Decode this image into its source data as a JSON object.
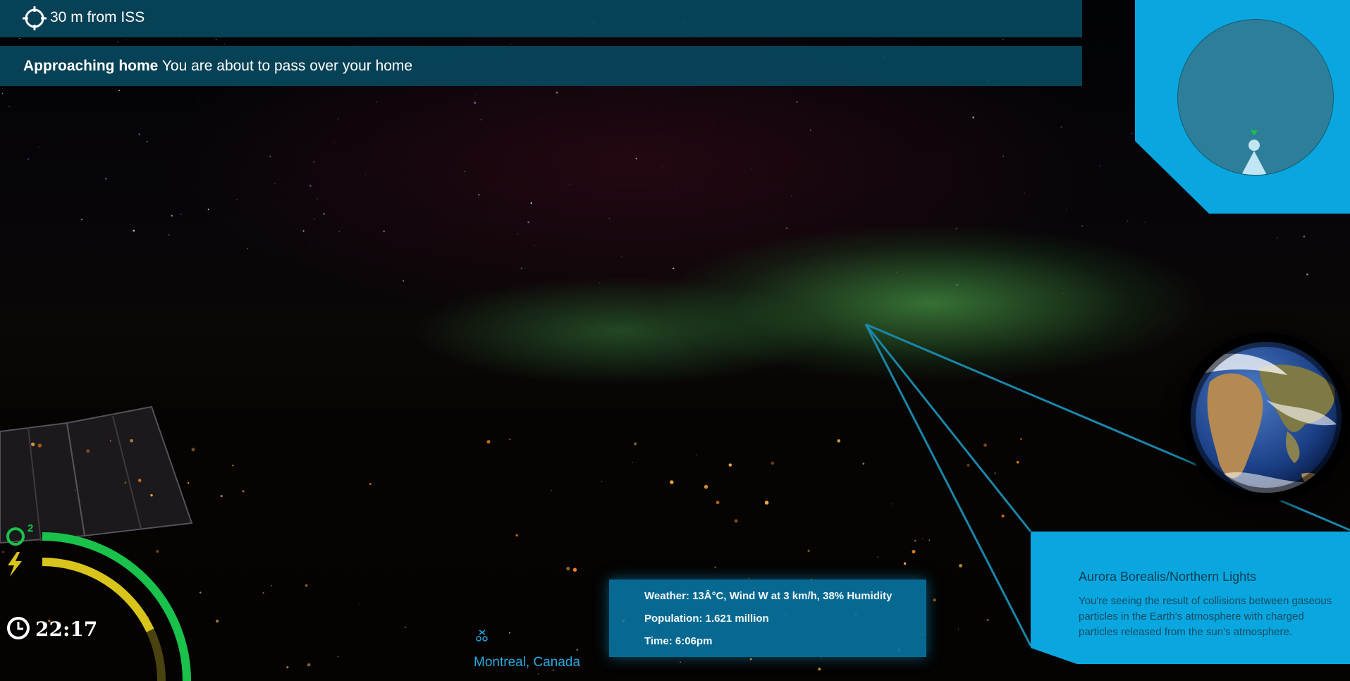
{
  "proximity": {
    "icon": "crosshair-icon",
    "text": "30 m from ISS"
  },
  "notification": {
    "title": "Approaching home",
    "message": "You are about to pass over your home"
  },
  "minimap": {
    "player_icon": "player-marker-icon",
    "direction_icon": "direction-arrow-icon"
  },
  "city": {
    "name": "Montreal, Canada",
    "weather": "Weather: 13Â°C, Wind W at 3 km/h, 38% Humidity",
    "population": "Population: 1.621 million",
    "time": "Time: 6:06pm"
  },
  "info": {
    "title": "Aurora Borealis/Northern Lights",
    "lines": [
      "You're seeing the result of collisions between gaseous",
      "particles in the Earth's atmosphere with charged",
      "particles released from the sun's atmosphere."
    ]
  },
  "status": {
    "oxygen_label": "O",
    "oxygen_sup": "2",
    "oxygen_icon": "oxygen-icon",
    "power_icon": "lightning-icon",
    "clock_icon": "clock-icon",
    "clock": "22:17",
    "oxygen_level": 1.0,
    "power_level": 0.72,
    "colors": {
      "oxygen": "#19c24a",
      "power": "#d9c41c",
      "ui_blue": "#0aa6df"
    }
  },
  "globe": {
    "icon": "earth-globe-icon"
  }
}
